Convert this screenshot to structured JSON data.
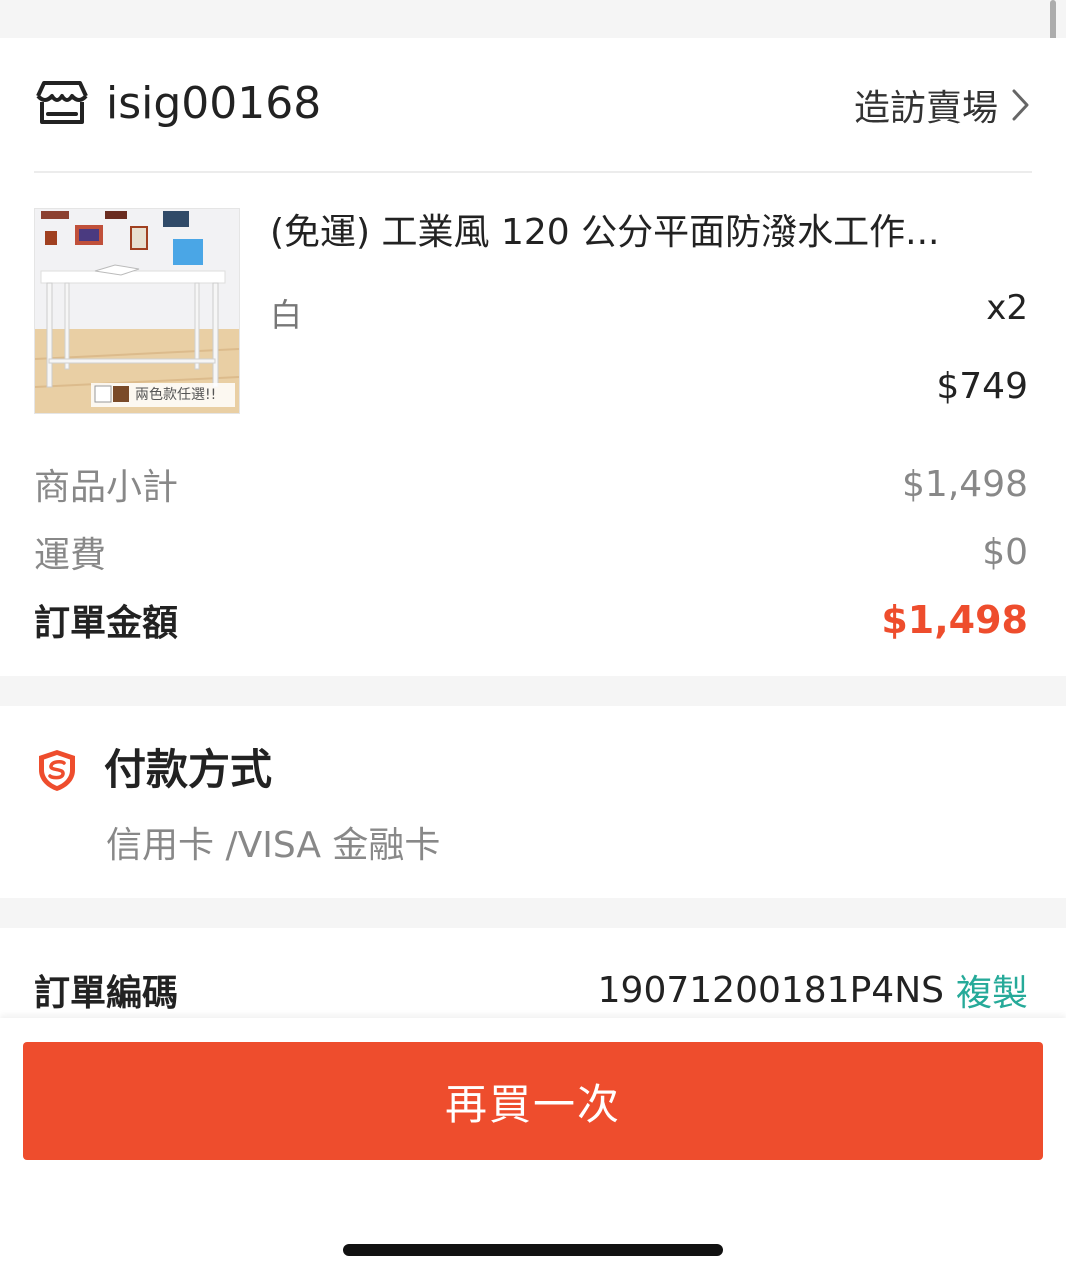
{
  "shop": {
    "name": "isig00168",
    "visit_label": "造訪賣場"
  },
  "product": {
    "title": "(免運) 工業風 120 公分平面防潑水工作...",
    "variant": "白",
    "quantity": "x2",
    "price": "$749",
    "image_caption": "兩色款任選!!"
  },
  "summary": {
    "subtotal_label": "商品小計",
    "subtotal_value": "$1,498",
    "shipping_label": "運費",
    "shipping_value": "$0",
    "total_label": "訂單金額",
    "total_value": "$1,498"
  },
  "payment": {
    "title": "付款方式",
    "method": "信用卡 /VISA 金融卡"
  },
  "order": {
    "id_label": "訂單編碼",
    "id_value": "19071200181P4NS",
    "copy_label": "複製"
  },
  "actions": {
    "buy_again_label": "再買一次"
  },
  "colors": {
    "accent": "#ee4d2d",
    "link_teal": "#26aa99"
  },
  "icons": {
    "shop": "shop-icon",
    "chevron": "chevron-right-icon",
    "payment": "shield-icon"
  }
}
